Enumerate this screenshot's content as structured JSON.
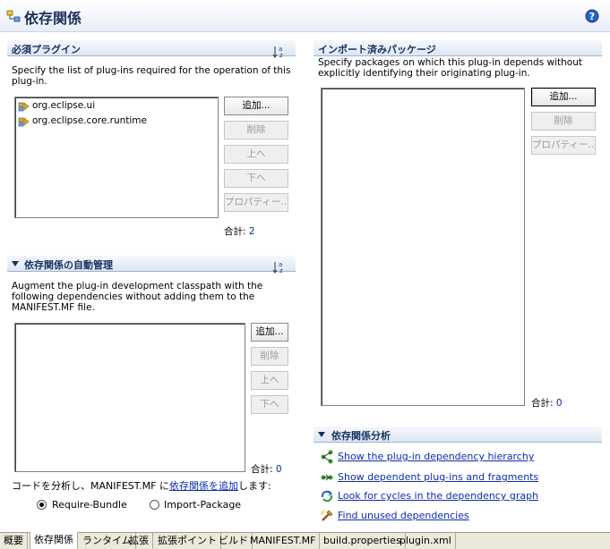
{
  "header": {
    "title": "依存関係",
    "help_icon": "help-icon"
  },
  "required_plugins": {
    "title": "必須プラグイン",
    "description": "Specify the list of plug-ins required for the operation of this plug-in.",
    "items": [
      "org.eclipse.ui",
      "org.eclipse.core.runtime"
    ],
    "buttons": {
      "add": "追加...",
      "remove": "削除",
      "up": "上へ",
      "down": "下へ",
      "properties": "プロパティー..."
    },
    "total_label": "合計:",
    "total_value": "2"
  },
  "imported_packages": {
    "title": "インポート済みパッケージ",
    "description": "Specify packages on which this plug-in depends without explicitly identifying their originating plug-in.",
    "buttons": {
      "add": "追加...",
      "remove": "削除",
      "properties": "プロパティー..."
    },
    "total_label": "合計:",
    "total_value": "0"
  },
  "auto_management": {
    "title": "依存関係の自動管理",
    "description": "Augment the plug-in development classpath with the following dependencies without adding them to the MANIFEST.MF file.",
    "buttons": {
      "add": "追加...",
      "remove": "削除",
      "up": "上へ",
      "down": "下へ"
    },
    "total_label": "合計:",
    "total_value": "0",
    "analyze_prefix": "コードを分析し、MANIFEST.MF に",
    "analyze_link": "依存関係を追加",
    "analyze_suffix": "します:",
    "radio_options": [
      "Require-Bundle",
      "Import-Package"
    ],
    "radio_selected": "Require-Bundle"
  },
  "analysis": {
    "title": "依存関係分析",
    "links": [
      "Show the plug-in dependency hierarchy",
      "Show dependent plug-ins and fragments",
      "Look for cycles in the dependency graph",
      "Find unused dependencies"
    ]
  },
  "tabs": [
    "概要",
    "依存関係",
    "ランタイム",
    "拡張",
    "拡張ポイント",
    "ビルド",
    "MANIFEST.MF",
    "build.properties",
    "plugin.xml"
  ],
  "active_tab": "依存関係",
  "colors": {
    "link": "#0a2cb0",
    "section_title": "#15315e",
    "header_title": "#1c2f5c"
  }
}
